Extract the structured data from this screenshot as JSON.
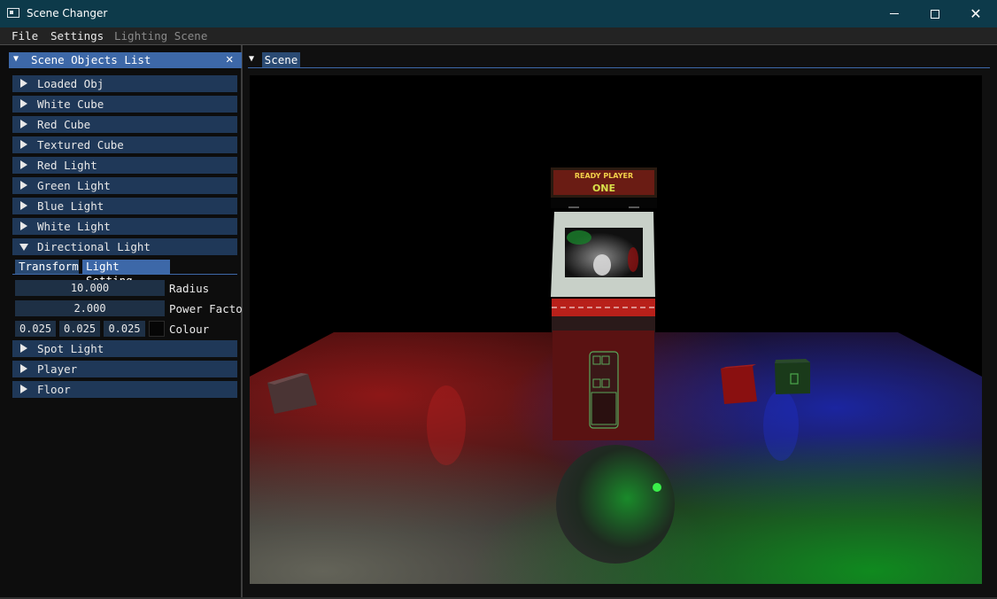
{
  "window": {
    "title": "Scene Changer",
    "controls": {
      "minimize": "minimize",
      "maximize": "maximize",
      "close": "✕"
    }
  },
  "menubar": {
    "items": [
      {
        "label": "File",
        "enabled": true
      },
      {
        "label": "Settings",
        "enabled": true
      },
      {
        "label": "Lighting Scene",
        "enabled": false
      }
    ]
  },
  "objects_panel": {
    "tab_label": "Scene Objects List",
    "close_glyph": "✕",
    "items": [
      {
        "label": "Loaded Obj",
        "expanded": false
      },
      {
        "label": "White Cube",
        "expanded": false
      },
      {
        "label": "Red Cube",
        "expanded": false
      },
      {
        "label": "Textured Cube",
        "expanded": false
      },
      {
        "label": "Red Light",
        "expanded": false
      },
      {
        "label": "Green Light",
        "expanded": false
      },
      {
        "label": "Blue Light",
        "expanded": false
      },
      {
        "label": "White Light",
        "expanded": false
      },
      {
        "label": "Directional Light",
        "expanded": true
      },
      {
        "label": "Spot Light",
        "expanded": false
      },
      {
        "label": "Player",
        "expanded": false
      },
      {
        "label": "Floor",
        "expanded": false
      }
    ],
    "directional_light": {
      "tabs": [
        {
          "label": "Transform",
          "active": false
        },
        {
          "label": "Light Setting",
          "active": true
        }
      ],
      "radius": {
        "value": "10.000",
        "label": "Radius"
      },
      "power_factor": {
        "value": "2.000",
        "label": "Power Facto"
      },
      "colour": {
        "r": "0.025",
        "g": "0.025",
        "b": "0.025",
        "label": "Colour",
        "swatch": "#060606"
      }
    }
  },
  "scene_panel": {
    "tab_label": "Scene",
    "arcade_marquee": {
      "line1": "READY PLAYER",
      "line2": "ONE"
    }
  },
  "colors": {
    "titlebar": "#0d3a4a",
    "header_active": "#3d68a8",
    "header": "#1f3858",
    "frame": "#1e3045"
  }
}
